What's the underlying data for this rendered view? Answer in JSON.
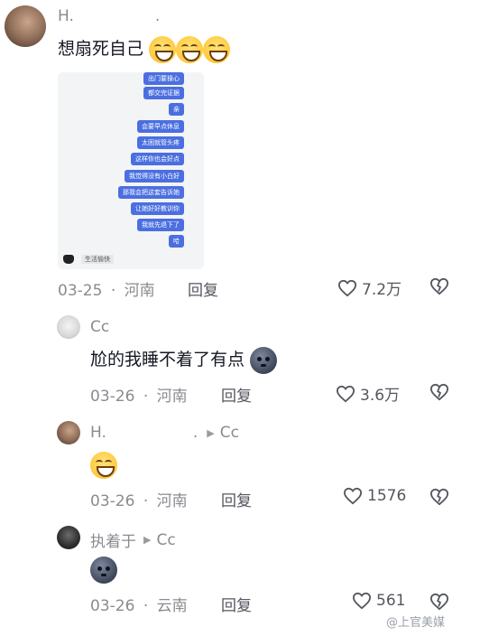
{
  "comments": [
    {
      "user": "H.",
      "user_suffix": ".",
      "text": "想扇死自己",
      "date": "03-25",
      "location": "河南",
      "reply_label": "回复",
      "likes": "7.2万",
      "attachment": {
        "bubbles": [
          "出门要操心",
          "都交完证据",
          "亲",
          "会要早点休息",
          "太困就管头疼",
          "这样你也会好点",
          "我觉得没有小白好",
          "那我会把这套告诉她",
          "让她好好教训你",
          "我就先退下了",
          "哈"
        ],
        "caption": "生活愉快"
      }
    },
    {
      "user": "Cc",
      "text": "尬的我睡不着了有点",
      "date": "03-26",
      "location": "河南",
      "reply_label": "回复",
      "likes": "3.6万"
    },
    {
      "user": "H.",
      "user_suffix": ".",
      "reply_to": "Cc",
      "date": "03-26",
      "location": "河南",
      "reply_label": "回复",
      "likes": "1576"
    },
    {
      "user": "执着于",
      "reply_to": "Cc",
      "date": "03-26",
      "location": "云南",
      "reply_label": "回复",
      "likes": "561"
    }
  ],
  "separator": "·",
  "watermark": "@上官美媒",
  "icons": [
    "heart-icon",
    "dislike-icon",
    "reply-arrow-icon",
    "grin-emoji",
    "sleepy-emoji"
  ],
  "colors": {
    "bubble": "#4b6fe0",
    "meta": "#8a8b91",
    "text": "#161823"
  }
}
